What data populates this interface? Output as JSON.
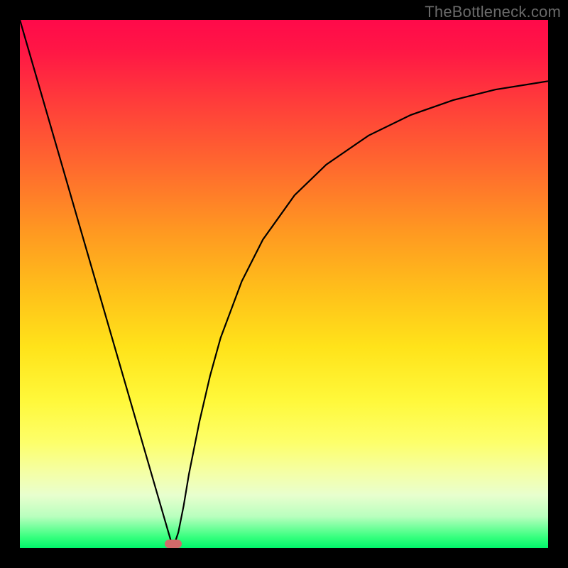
{
  "attribution": "TheBottleneck.com",
  "colors": {
    "frame": "#000000",
    "curve": "#000000",
    "marker": "#d16a6a",
    "attribution": "#6a6a6a"
  },
  "chart_data": {
    "type": "line",
    "title": "",
    "xlabel": "",
    "ylabel": "",
    "xlim": [
      0,
      100
    ],
    "ylim": [
      0,
      100
    ],
    "x": [
      0,
      4,
      8,
      12,
      16,
      20,
      24,
      26,
      28,
      29,
      30,
      31,
      32,
      34,
      36,
      38,
      42,
      46,
      52,
      58,
      66,
      74,
      82,
      90,
      100
    ],
    "values": [
      100,
      86.2,
      72.4,
      58.6,
      44.8,
      31.0,
      17.2,
      10.3,
      3.4,
      0.0,
      3.0,
      8.0,
      14.0,
      24.0,
      32.6,
      39.8,
      50.5,
      58.4,
      66.8,
      72.6,
      78.1,
      82.0,
      84.8,
      86.8,
      88.4
    ],
    "minimum": {
      "x": 29,
      "y": 0
    },
    "annotations": []
  },
  "marker": {
    "left_pct": 29,
    "bottom_pct": 0.8
  }
}
